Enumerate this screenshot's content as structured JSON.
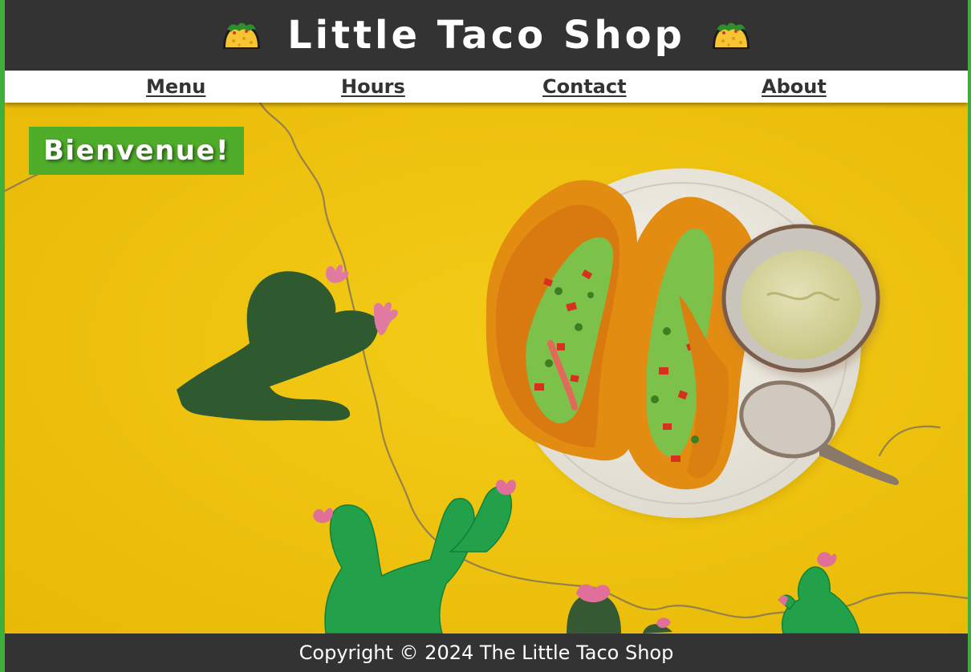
{
  "header": {
    "title": "Little Taco Shop",
    "left_icon": "taco-icon",
    "right_icon": "taco-icon"
  },
  "nav": {
    "items": [
      {
        "label": "Menu"
      },
      {
        "label": "Hours"
      },
      {
        "label": "Contact"
      },
      {
        "label": "About"
      }
    ]
  },
  "hero": {
    "welcome_text": "Bienvenue!",
    "image_subject": "tacos-on-plate-with-paper-cactus-decorations"
  },
  "footer": {
    "copyright": "Copyright © 2024 The Little Taco Shop"
  },
  "colors": {
    "page_border": "#3fae3a",
    "header_bg": "#333333",
    "nav_bg": "#ffffff",
    "nav_text": "#333333",
    "badge_bg": "#4fad2a",
    "hero_yellow": "#f0c512"
  }
}
